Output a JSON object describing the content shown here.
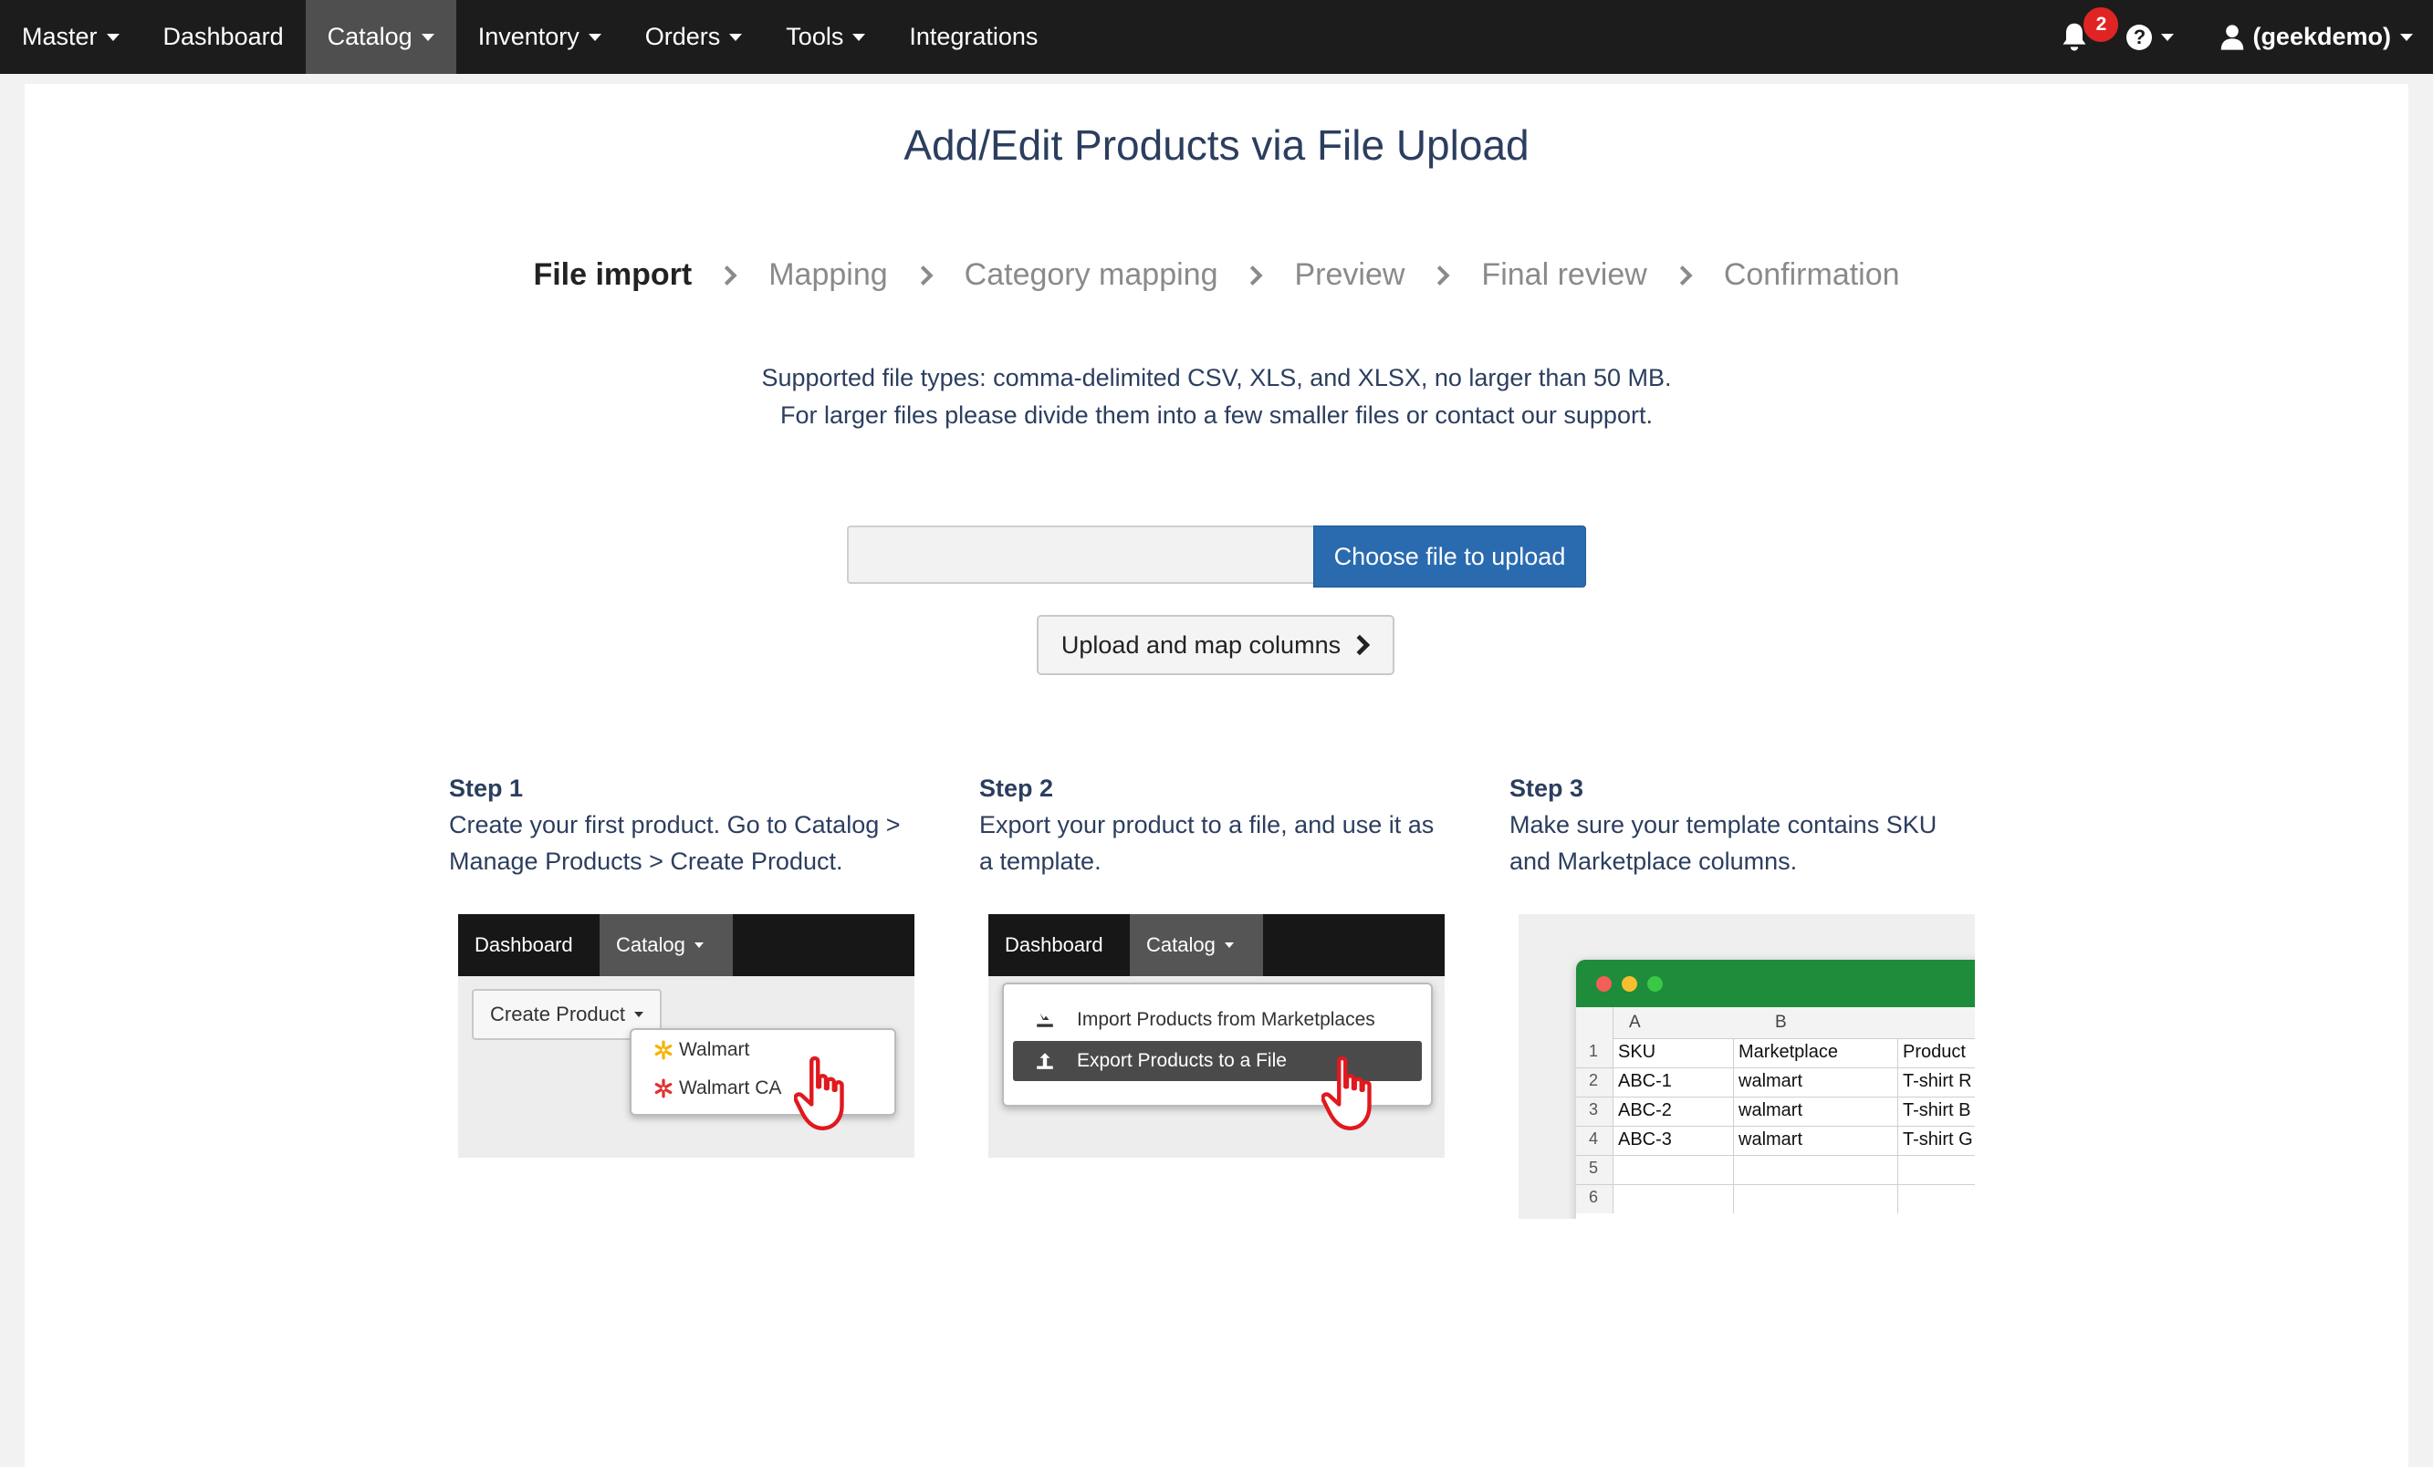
{
  "navbar": {
    "master": "Master",
    "dashboard": "Dashboard",
    "catalog": "Catalog",
    "inventory": "Inventory",
    "orders": "Orders",
    "tools": "Tools",
    "integrations": "Integrations",
    "notifications_count": "2",
    "user": "(geekdemo)"
  },
  "page": {
    "title": "Add/Edit Products via File Upload"
  },
  "wizard": {
    "steps": [
      "File import",
      "Mapping",
      "Category mapping",
      "Preview",
      "Final review",
      "Confirmation"
    ],
    "current": "File import"
  },
  "info": {
    "line1": "Supported file types: comma-delimited CSV, XLS, and XLSX, no larger than 50 MB.",
    "line2": "For larger files please divide them into a few smaller files or contact our support."
  },
  "upload": {
    "file_value": "",
    "choose_label": "Choose file to upload",
    "map_label": "Upload and map columns"
  },
  "steps": [
    {
      "heading": "Step 1",
      "text": "Create your first product. Go to Catalog > Manage Products > Create Product."
    },
    {
      "heading": "Step 2",
      "text": "Export your product to a file, and use it as a template."
    },
    {
      "heading": "Step 3",
      "text": "Make sure your template contains SKU and Marketplace columns."
    }
  ],
  "illustration1": {
    "tab_dashboard": "Dashboard",
    "tab_catalog": "Catalog",
    "create_product": "Create Product",
    "menu": [
      "Walmart",
      "Walmart CA"
    ]
  },
  "illustration2": {
    "tab_dashboard": "Dashboard",
    "tab_catalog": "Catalog",
    "menu": [
      "Import Products from Marketplaces",
      "Export Products to a File"
    ]
  },
  "illustration3": {
    "col_headers": [
      "A",
      "B"
    ],
    "row_numbers": [
      "1",
      "2",
      "3",
      "4",
      "5",
      "6"
    ],
    "rows": [
      [
        "SKU",
        "Marketplace",
        "Product"
      ],
      [
        "ABC-1",
        "walmart",
        "T-shirt R"
      ],
      [
        "ABC-2",
        "walmart",
        "T-shirt B"
      ],
      [
        "ABC-3",
        "walmart",
        "T-shirt G"
      ]
    ]
  },
  "colors": {
    "navbar_bg": "#1c1c1c",
    "primary_button": "#2a6bb0",
    "badge": "#e02424",
    "title": "#2c3e5f",
    "excel_green": "#1e8c3a"
  }
}
